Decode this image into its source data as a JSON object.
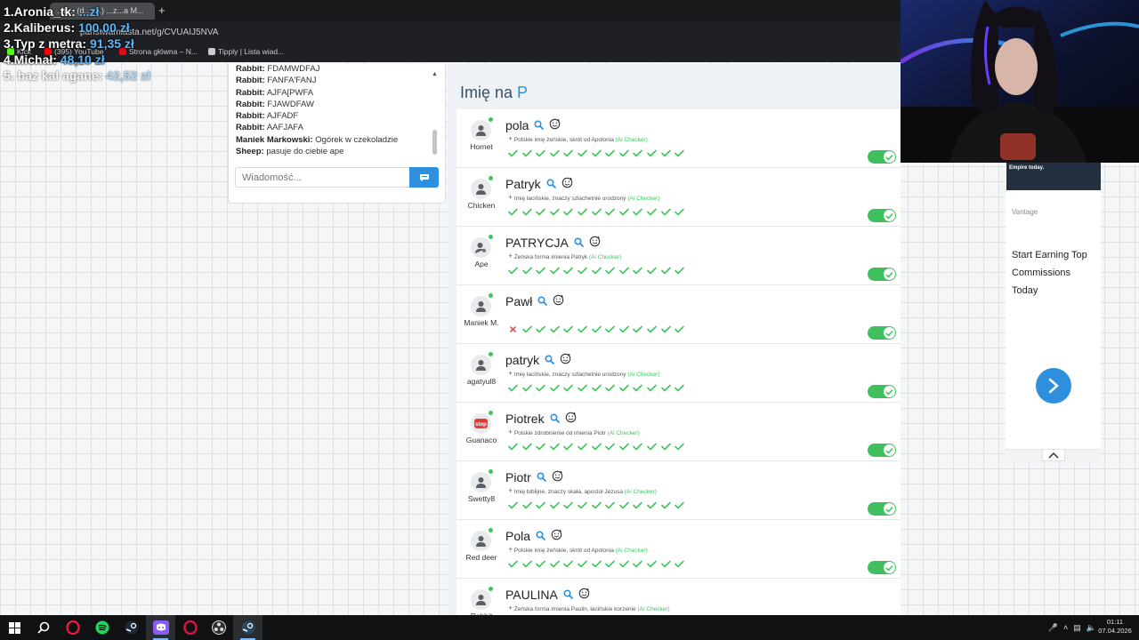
{
  "browser": {
    "tab_title": "...n... (d...z...) ...z...a M...",
    "new_tab": "+",
    "url": "panstwamiasta.net/g/CVUAIJ5NVA",
    "bookmarks": [
      {
        "label": "Kick",
        "color": "#53fc18"
      },
      {
        "label": "(395) YouTube",
        "color": "#ff0000"
      },
      {
        "label": "Strona główna – N...",
        "color": "#e50914"
      },
      {
        "label": "Tipply | Lista wiad...",
        "color": "#cccccc"
      }
    ]
  },
  "leaderboard": [
    {
      "name": "1.Aronia_tk:",
      "amount": "...zł"
    },
    {
      "name": "2.Kaliberus:",
      "amount": "100,00 zł"
    },
    {
      "name": "3.Typ z metra:",
      "amount": "91,35 zł"
    },
    {
      "name": "4.Michał:",
      "amount": "48,10 zł"
    },
    {
      "name": "5. baz kal agane:",
      "amount": "42,52 zł"
    }
  ],
  "chat": {
    "messages": [
      {
        "author": "Rabbit:",
        "text": "FDAMWDFAJ"
      },
      {
        "author": "Rabbit:",
        "text": "FANFA'FANJ"
      },
      {
        "author": "Rabbit:",
        "text": "AJFA[PWFA"
      },
      {
        "author": "Rabbit:",
        "text": "FJAWDFAW"
      },
      {
        "author": "Rabbit:",
        "text": "AJFADF"
      },
      {
        "author": "Rabbit:",
        "text": "AAFJAFA"
      },
      {
        "author": "Maniek Markowski:",
        "text": "Ogórek w czekoladzie"
      },
      {
        "author": "Sheep:",
        "text": "pasuje do ciebie ape"
      }
    ],
    "input_placeholder": "Wiadomość..."
  },
  "main": {
    "title_prefix": "Imię na ",
    "title_letter": "P",
    "ai_label": "(Ai Checker)",
    "entries": [
      {
        "word": "pola",
        "author": "Hornet",
        "avatar": "person-icon",
        "desc": "Polskie imię żeńskie, skrót od Apolonia",
        "checks": "ooooooooooooo",
        "toggle_on": true
      },
      {
        "word": "Patryk",
        "author": "Chicken",
        "avatar": "person-icon",
        "desc": "Imię łacińskie, znaczy szlachetnie urodzony",
        "checks": "ooooooooooooo",
        "toggle_on": true
      },
      {
        "word": "PATRYCJA",
        "author": "Ape",
        "avatar": "person-star-icon",
        "desc": "Żeńska forma imienia Patryk",
        "checks": "ooooooooooooo",
        "toggle_on": true
      },
      {
        "word": "Pawł",
        "author": "Maniek M.",
        "avatar": "person-icon",
        "desc": "",
        "checks": "xoooooooooooo",
        "toggle_on": true
      },
      {
        "word": "patryk",
        "author": "agatyul8",
        "avatar": "person-icon",
        "desc": "Imię łacińskie, znaczy szlachetnie urodzony",
        "checks": "ooooooooooooo",
        "toggle_on": true
      },
      {
        "word": "Piotrek",
        "author": "Guanaco",
        "avatar": "stop-sign-icon",
        "desc": "Polskie zdrobnienie od imienia Piotr",
        "checks": "ooooooooooooo",
        "toggle_on": true
      },
      {
        "word": "Piotr",
        "author": "Swetty8",
        "avatar": "person-icon",
        "desc": "Imię biblijne, znaczy skała, apostoł Jezusa",
        "checks": "ooooooooooooo",
        "toggle_on": true
      },
      {
        "word": "Pola",
        "author": "Red deer",
        "avatar": "person-icon",
        "desc": "Polskie imię żeńskie, skrót od Apolonia",
        "checks": "ooooooooooooo",
        "toggle_on": true
      },
      {
        "word": "PAULINA",
        "author": "Rabbit",
        "avatar": "person-icon",
        "desc": "Żeńska forma imienia Paulin, łacińskie korzenie",
        "checks": "ooooooooooooo",
        "toggle_on": true
      }
    ],
    "colors": {
      "accent": "#2e8fde",
      "check": "#3cc65c",
      "cross": "#e53935"
    }
  },
  "ad": {
    "banner_text": "Empire today.",
    "brand": "Vantage",
    "headline": "Start Earning Top Commissions Today"
  },
  "taskbar": {
    "apps": [
      "windows-start-icon",
      "search-icon",
      "opera-gx-icon",
      "spotify-icon",
      "steam-icon",
      "discord-icon",
      "opera-icon",
      "obs-icon",
      "steam-active-icon"
    ],
    "clock_time": "01:11",
    "clock_date": "07.04.2026"
  }
}
